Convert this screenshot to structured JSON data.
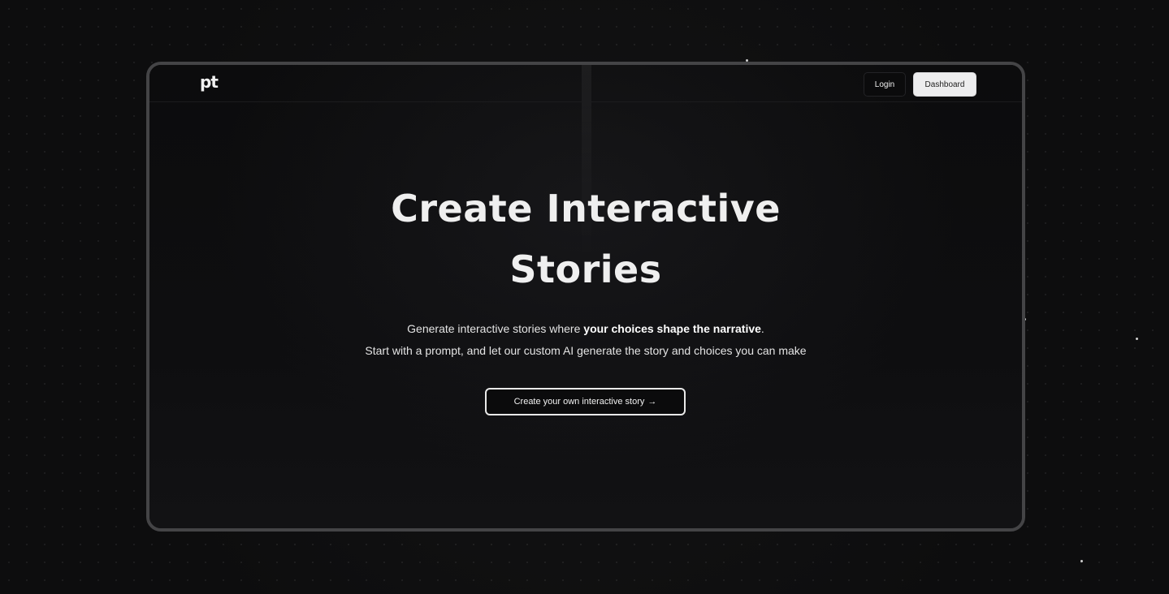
{
  "nav": {
    "logo_text": "pt",
    "login_label": "Login",
    "dashboard_label": "Dashboard"
  },
  "hero": {
    "title_line1": "Create Interactive",
    "title_line2": "Stories",
    "subtitle_part1": "Generate interactive stories where ",
    "subtitle_bold": "your choices shape the narrative",
    "subtitle_part2": ".",
    "subtitle_line2": "Start with a prompt, and let our custom AI generate the story and choices you can make",
    "cta_label": "Create your own interactive story",
    "cta_arrow": "→"
  },
  "colors": {
    "background": "#0e0e0f",
    "frame_border": "#444446",
    "text": "#efefef",
    "dashboard_bg": "#ededee"
  }
}
